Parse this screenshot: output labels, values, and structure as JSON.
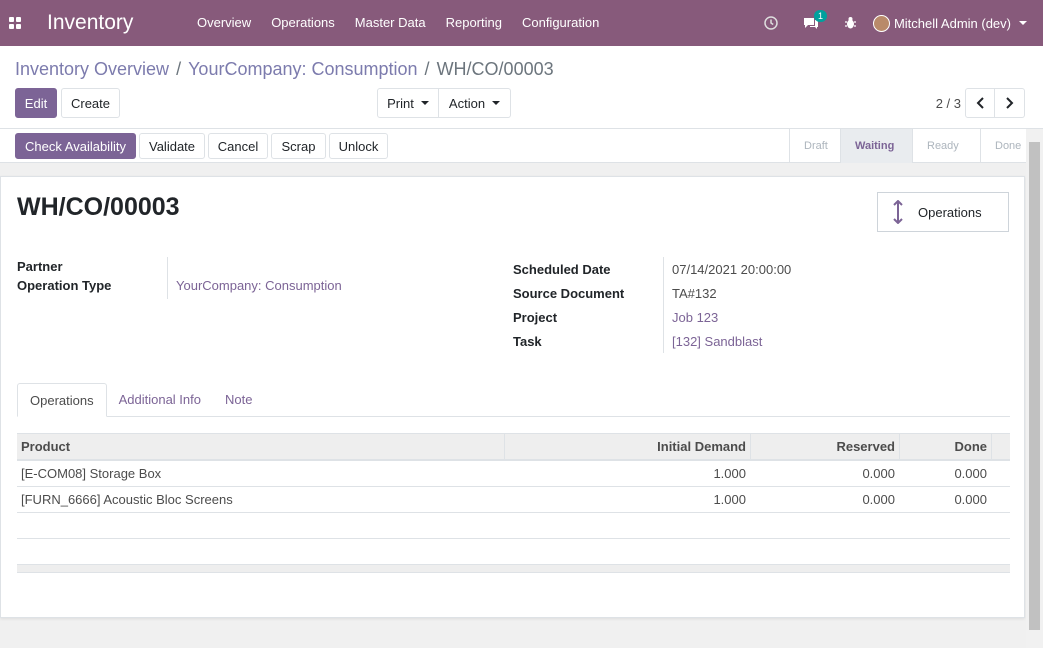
{
  "navbar": {
    "app_title": "Inventory",
    "menu": [
      "Overview",
      "Operations",
      "Master Data",
      "Reporting",
      "Configuration"
    ],
    "chat_badge": "1",
    "user_name": "Mitchell Admin (dev)"
  },
  "breadcrumb": {
    "level1": "Inventory Overview",
    "level2": "YourCompany: Consumption",
    "current": "WH/CO/00003"
  },
  "control": {
    "edit_label": "Edit",
    "create_label": "Create",
    "print_label": "Print",
    "action_label": "Action",
    "pager_value": "2 / 3"
  },
  "statusbar": {
    "buttons": [
      "Check Availability",
      "Validate",
      "Cancel",
      "Scrap",
      "Unlock"
    ],
    "stages": [
      "Draft",
      "Waiting",
      "Ready",
      "Done"
    ],
    "active_stage": "Waiting"
  },
  "record": {
    "title": "WH/CO/00003",
    "smart_button_label": "Operations",
    "left_fields": [
      {
        "label": "Partner",
        "value": ""
      },
      {
        "label": "Operation Type",
        "value": "YourCompany: Consumption"
      }
    ],
    "right_fields": [
      {
        "label": "Scheduled Date",
        "value": "07/14/2021 20:00:00"
      },
      {
        "label": "Source Document",
        "value": "TA#132"
      },
      {
        "label": "Project",
        "value": "Job 123"
      },
      {
        "label": "Task",
        "value": "[132] Sandblast"
      }
    ]
  },
  "tabs": [
    "Operations",
    "Additional Info",
    "Note"
  ],
  "table": {
    "columns": [
      "Product",
      "Initial Demand",
      "Reserved",
      "Done"
    ],
    "rows": [
      [
        "[E-COM08] Storage Box",
        "1.000",
        "0.000",
        "0.000"
      ],
      [
        "[FURN_6666] Acoustic Bloc Screens",
        "1.000",
        "0.000",
        "0.000"
      ]
    ]
  },
  "colors": {
    "navbar": "#875a7b",
    "primary": "#7c6496",
    "link": "#7c7bad"
  }
}
